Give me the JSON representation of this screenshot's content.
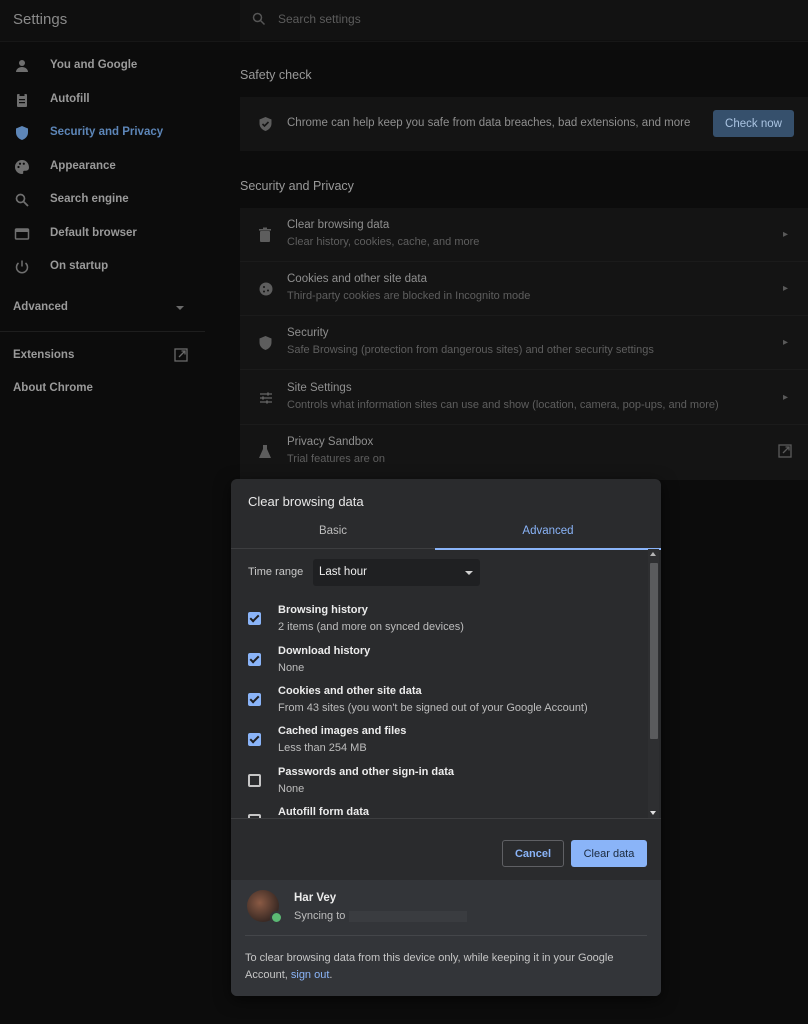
{
  "app_title": "Settings",
  "search": {
    "placeholder": "Search settings"
  },
  "sidebar": {
    "items": [
      {
        "label": "You and Google",
        "icon": "person-icon"
      },
      {
        "label": "Autofill",
        "icon": "clipboard-icon"
      },
      {
        "label": "Security and Privacy",
        "icon": "shield-icon",
        "active": true
      },
      {
        "label": "Appearance",
        "icon": "palette-icon"
      },
      {
        "label": "Search engine",
        "icon": "search-icon"
      },
      {
        "label": "Default browser",
        "icon": "browser-icon"
      },
      {
        "label": "On startup",
        "icon": "power-icon"
      }
    ],
    "advanced": "Advanced",
    "extensions": "Extensions",
    "about": "About Chrome"
  },
  "safety_check": {
    "title": "Safety check",
    "text": "Chrome can help keep you safe from data breaches, bad extensions, and more",
    "button": "Check now"
  },
  "security_privacy": {
    "title": "Security and Privacy",
    "rows": [
      {
        "title": "Clear browsing data",
        "subtitle": "Clear history, cookies, cache, and more"
      },
      {
        "title": "Cookies and other site data",
        "subtitle": "Third-party cookies are blocked in Incognito mode"
      },
      {
        "title": "Security",
        "subtitle": "Safe Browsing (protection from dangerous sites) and other security settings"
      },
      {
        "title": "Site Settings",
        "subtitle": "Controls what information sites can use and show (location, camera, pop-ups, and more)"
      },
      {
        "title": "Privacy Sandbox",
        "subtitle": "Trial features are on"
      }
    ]
  },
  "dialog": {
    "title": "Clear browsing data",
    "tabs": {
      "basic": "Basic",
      "advanced": "Advanced"
    },
    "time_range_label": "Time range",
    "time_range_value": "Last hour",
    "options": [
      {
        "title": "Browsing history",
        "subtitle": "2 items (and more on synced devices)",
        "checked": true
      },
      {
        "title": "Download history",
        "subtitle": "None",
        "checked": true
      },
      {
        "title": "Cookies and other site data",
        "subtitle": "From 43 sites (you won't be signed out of your Google Account)",
        "checked": true
      },
      {
        "title": "Cached images and files",
        "subtitle": "Less than 254 MB",
        "checked": true
      },
      {
        "title": "Passwords and other sign-in data",
        "subtitle": "None",
        "checked": false
      },
      {
        "title": "Autofill form data",
        "subtitle": "",
        "checked": false
      }
    ],
    "cancel": "Cancel",
    "clear": "Clear data",
    "user_name": "Har Vey",
    "syncing": "Syncing to",
    "footer_text": "To clear browsing data from this device only, while keeping it in your Google Account,",
    "footer_link": "sign out",
    "footer_end": "."
  },
  "colors": {
    "accent": "#8ab4f8",
    "dialog_bg": "#2a2b2d",
    "page_bg": "#0c0c0c"
  }
}
